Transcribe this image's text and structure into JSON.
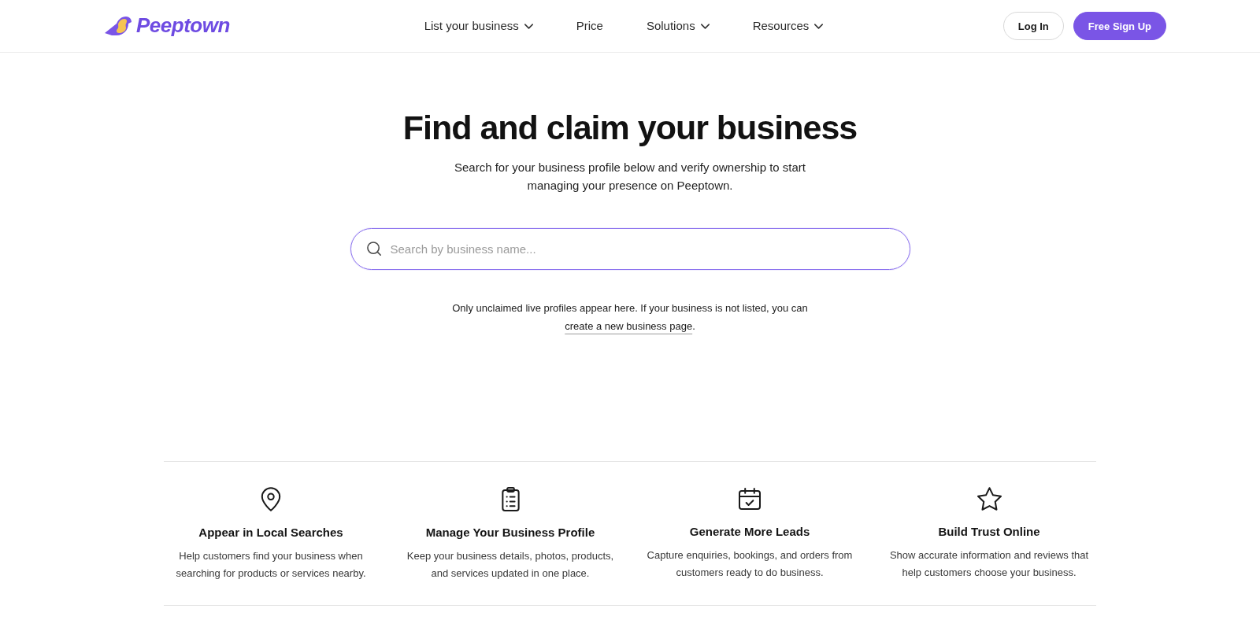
{
  "header": {
    "logo": {
      "text": "Peeptown"
    },
    "nav": [
      {
        "label": "List your business",
        "kind": "dropdown"
      },
      {
        "label": "Price",
        "kind": "link"
      },
      {
        "label": "Solutions",
        "kind": "dropdown"
      },
      {
        "label": "Resources",
        "kind": "dropdown"
      }
    ],
    "buttons": [
      {
        "label": "Log In",
        "kind": "outline"
      },
      {
        "label": "Free Sign Up",
        "kind": "primary"
      }
    ]
  },
  "hero": {
    "title": "Find and claim your business",
    "subtitle": "Search for your business profile below and verify ownership to start managing your presence on Peeptown.",
    "search": {
      "placeholder": "Search by business name...",
      "focused": true
    },
    "note": {
      "text": "Only unclaimed live profiles appear here. If your business is not listed, you can",
      "link": "create a new business page",
      "suffix": "."
    }
  },
  "features": [
    {
      "title": "Appear in Local Searches",
      "description": "Help customers find your business when searching for products or services nearby."
    },
    {
      "title": "Manage Your Business Profile",
      "description": "Keep your business details, photos, products, and services updated in one place."
    },
    {
      "title": "Generate More Leads",
      "description": "Capture enquiries, bookings, and orders from customers ready to do business."
    },
    {
      "title": "Build Trust Online",
      "description": "Show accurate information and reviews that help customers choose your business."
    }
  ]
}
